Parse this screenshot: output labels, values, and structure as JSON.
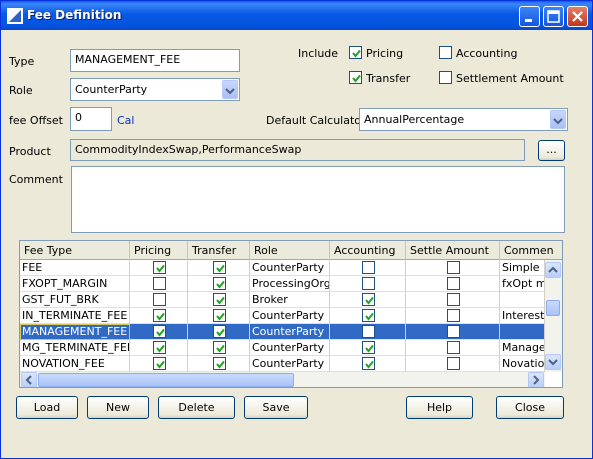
{
  "window": {
    "title": "Fee Definition"
  },
  "form": {
    "type_label": "Type",
    "type_value": "MANAGEMENT_FEE",
    "role_label": "Role",
    "role_value": "CounterParty",
    "fee_offset_label": "fee Offset",
    "fee_offset_value": "0",
    "fee_offset_unit": "Cal",
    "default_calculator_label": "Default Calculator",
    "default_calculator_value": "AnnualPercentage",
    "product_label": "Product",
    "product_value": "CommodityIndexSwap,PerformanceSwap",
    "product_button": "...",
    "comment_label": "Comment",
    "comment_value": ""
  },
  "include": {
    "label": "Include",
    "pricing": {
      "label": "Pricing",
      "checked": true
    },
    "transfer": {
      "label": "Transfer",
      "checked": true
    },
    "accounting": {
      "label": "Accounting",
      "checked": false
    },
    "settlement": {
      "label": "Settlement Amount",
      "checked": false
    }
  },
  "table": {
    "columns": [
      "Fee Type",
      "Pricing",
      "Transfer",
      "Role",
      "Accounting",
      "Settle Amount",
      "Commen"
    ],
    "rows": [
      {
        "fee_type": "FEE",
        "pricing": true,
        "transfer": true,
        "role": "CounterParty",
        "accounting": false,
        "settle": false,
        "comment": "Simple Fe"
      },
      {
        "fee_type": "FXOPT_MARGIN",
        "pricing": false,
        "transfer": true,
        "role": "ProcessingOrg",
        "accounting": false,
        "settle": false,
        "comment": "fxOpt ma"
      },
      {
        "fee_type": "GST_FUT_BRK",
        "pricing": false,
        "transfer": true,
        "role": "Broker",
        "accounting": true,
        "settle": false,
        "comment": ""
      },
      {
        "fee_type": "IN_TERMINATE_FEE",
        "pricing": true,
        "transfer": true,
        "role": "CounterParty",
        "accounting": true,
        "settle": false,
        "comment": "Interest T"
      },
      {
        "fee_type": "MANAGEMENT_FEE",
        "pricing": true,
        "transfer": true,
        "role": "CounterParty",
        "accounting": false,
        "settle": false,
        "comment": "",
        "selected": true
      },
      {
        "fee_type": "MG_TERMINATE_FEE",
        "pricing": true,
        "transfer": true,
        "role": "CounterParty",
        "accounting": true,
        "settle": false,
        "comment": "Managem"
      },
      {
        "fee_type": "NOVATION_FEE",
        "pricing": true,
        "transfer": true,
        "role": "CounterParty",
        "accounting": true,
        "settle": false,
        "comment": "Novation"
      }
    ]
  },
  "buttons": {
    "load": "Load",
    "new": "New",
    "delete": "Delete",
    "save": "Save",
    "help": "Help",
    "close": "Close"
  },
  "colors": {
    "titlebar": "#0a5ef0",
    "selection": "#316ac5",
    "check": "#21a121"
  }
}
